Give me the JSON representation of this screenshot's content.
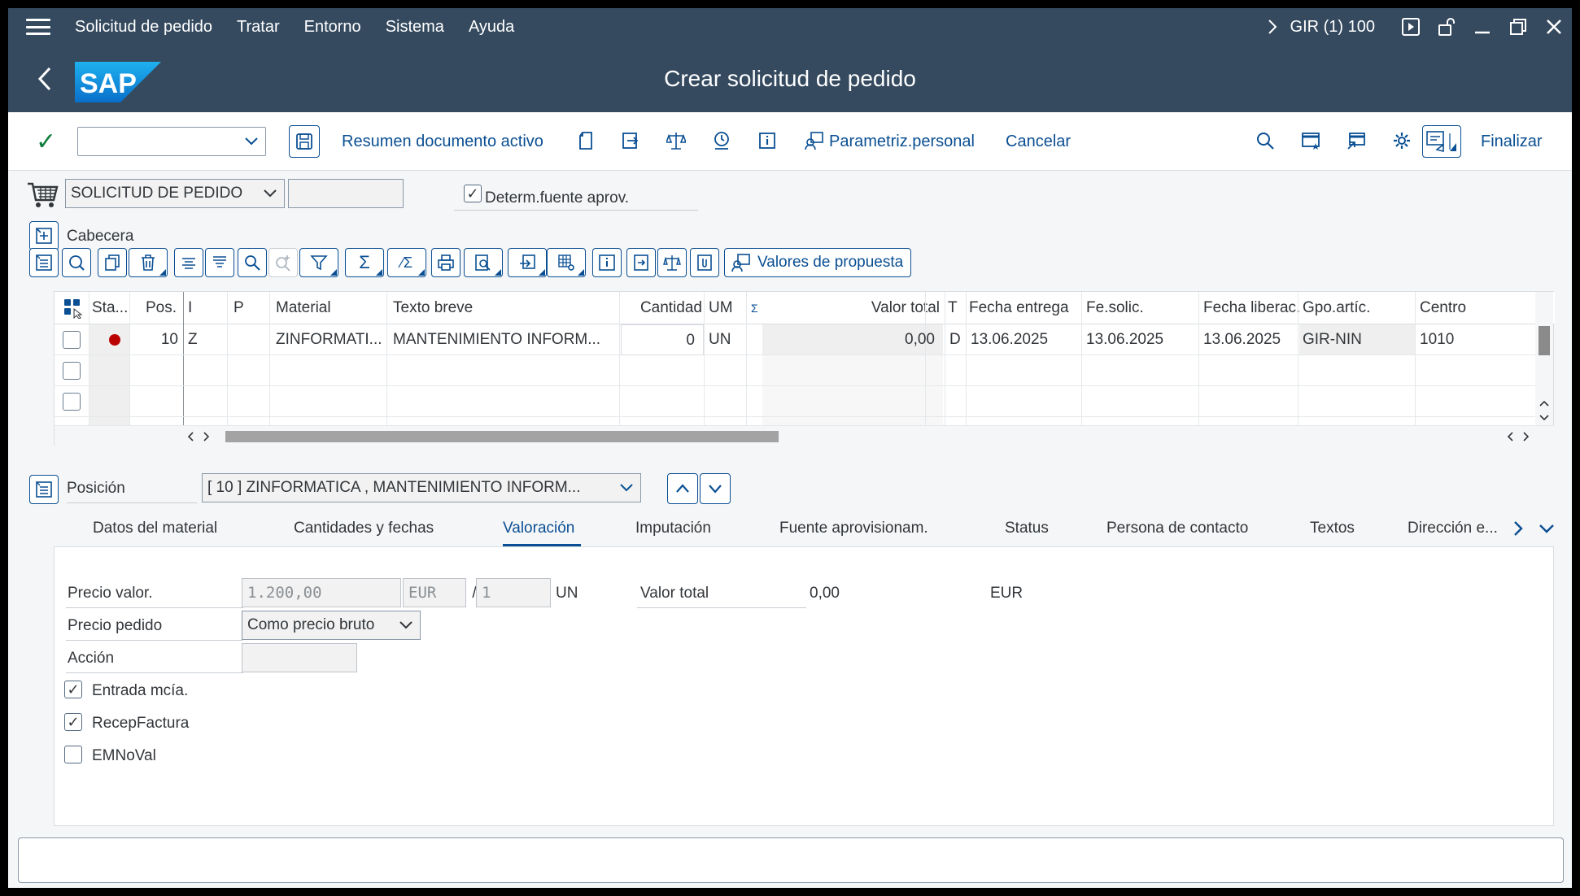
{
  "menubar": {
    "items": [
      "Solicitud de pedido",
      "Tratar",
      "Entorno",
      "Sistema",
      "Ayuda"
    ],
    "system_id": "GIR (1) 100"
  },
  "titlebar": {
    "title": "Crear solicitud de pedido",
    "logo_text": "SAP"
  },
  "toolbar": {
    "summary_label": "Resumen documento activo",
    "personal_label": "Parametriz.personal",
    "cancel_label": "Cancelar",
    "finish_label": "Finalizar"
  },
  "header": {
    "doc_type": "SOLICITUD DE PEDIDO",
    "determ_label": "Determ.fuente aprov.",
    "cabecera_label": "Cabecera"
  },
  "grid_toolbar": {
    "proposal_label": "Valores de propuesta"
  },
  "table": {
    "columns": [
      "Sta...",
      "Pos.",
      "I",
      "P",
      "Material",
      "Texto breve",
      "Cantidad",
      "UM",
      "Σ",
      "Valor total",
      "T",
      "Fecha entrega",
      "Fe.solic.",
      "Fecha liberac.",
      "Gpo.artíc.",
      "Centro"
    ],
    "rows": [
      {
        "pos": "10",
        "i": "Z",
        "p": "",
        "material": "ZINFORMATI...",
        "texto": "MANTENIMIENTO INFORM...",
        "cantidad": "0",
        "um": "UN",
        "valor": "0,00",
        "t": "D",
        "fecha_entrega": "13.06.2025",
        "fe_solic": "13.06.2025",
        "fecha_lib": "13.06.2025",
        "gpo": "GIR-NIN",
        "centro": "1010",
        "status_color": "#bb0000"
      }
    ]
  },
  "position": {
    "label": "Posición",
    "selected": "[ 10 ] ZINFORMATICA , MANTENIMIENTO INFORM..."
  },
  "tabs": [
    "Datos del material",
    "Cantidades y fechas",
    "Valoración",
    "Imputación",
    "Fuente aprovisionam.",
    "Status",
    "Persona de contacto",
    "Textos",
    "Dirección e..."
  ],
  "valuation": {
    "price_label": "Precio valor.",
    "price_value": "1.200,00",
    "currency": "EUR",
    "per": "/",
    "per_qty": "1",
    "per_unit": "UN",
    "total_label": "Valor total",
    "total_value": "0,00",
    "total_currency": "EUR",
    "order_price_label": "Precio pedido",
    "order_price_value": "Como precio bruto",
    "action_label": "Acción",
    "gr_label": "Entrada mcía.",
    "ir_label": "RecepFactura",
    "emnoval_label": "EMNoVal"
  }
}
